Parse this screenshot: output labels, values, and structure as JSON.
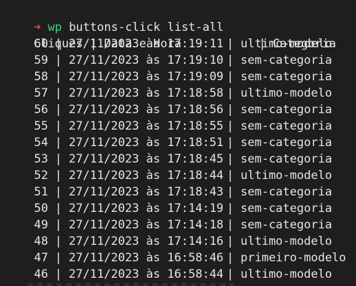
{
  "prompt": {
    "arrow": "➜",
    "directory": "wp",
    "command": "buttons-click list-all"
  },
  "table": {
    "headers": {
      "clicks": "Cliques",
      "datetime": "Data e Hora",
      "category": "Categoria"
    },
    "rows": [
      {
        "clicks": "60",
        "datetime": "27/11/2023 às 17:19:11",
        "category": "ultimo-modelo"
      },
      {
        "clicks": "59",
        "datetime": "27/11/2023 às 17:19:10",
        "category": "sem-categoria"
      },
      {
        "clicks": "58",
        "datetime": "27/11/2023 às 17:19:09",
        "category": "sem-categoria"
      },
      {
        "clicks": "57",
        "datetime": "27/11/2023 às 17:18:58",
        "category": "ultimo-modelo"
      },
      {
        "clicks": "56",
        "datetime": "27/11/2023 às 17:18:56",
        "category": "sem-categoria"
      },
      {
        "clicks": "55",
        "datetime": "27/11/2023 às 17:18:55",
        "category": "sem-categoria"
      },
      {
        "clicks": "54",
        "datetime": "27/11/2023 às 17:18:51",
        "category": "sem-categoria"
      },
      {
        "clicks": "53",
        "datetime": "27/11/2023 às 17:18:45",
        "category": "sem-categoria"
      },
      {
        "clicks": "52",
        "datetime": "27/11/2023 às 17:18:44",
        "category": "ultimo-modelo"
      },
      {
        "clicks": "51",
        "datetime": "27/11/2023 às 17:18:43",
        "category": "sem-categoria"
      },
      {
        "clicks": "50",
        "datetime": "27/11/2023 às 17:14:19",
        "category": "sem-categoria"
      },
      {
        "clicks": "49",
        "datetime": "27/11/2023 às 17:14:18",
        "category": "sem-categoria"
      },
      {
        "clicks": "48",
        "datetime": "27/11/2023 às 17:14:16",
        "category": "ultimo-modelo"
      },
      {
        "clicks": "47",
        "datetime": "27/11/2023 às 16:58:46",
        "category": "primeiro-modelo"
      },
      {
        "clicks": "46",
        "datetime": "27/11/2023 às 16:58:44",
        "category": "ultimo-modelo"
      }
    ]
  },
  "colors": {
    "background": "#1e1e1e",
    "text": "#e6e6e6",
    "prompt_arrow": "#e5534b",
    "prompt_directory": "#42d17a"
  }
}
